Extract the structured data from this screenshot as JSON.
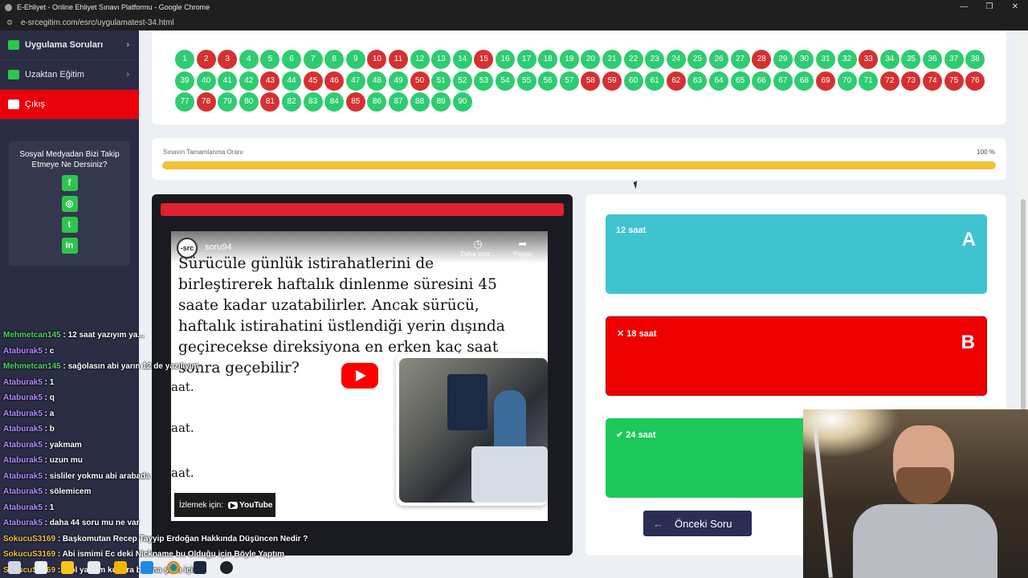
{
  "browser": {
    "window_title": "E-Ehliyet - Online Ehliyet Sınavı Platformu - Google Chrome",
    "url": "e-srcegitim.com/esrc/uygulamatest-34.html",
    "controls": [
      "—",
      "❐",
      "✕"
    ]
  },
  "sidebar": {
    "items": [
      {
        "label": "Uygulama Soruları",
        "chevron": "›"
      },
      {
        "label": "Uzaktan Eğitim",
        "chevron": "›"
      },
      {
        "label": "Çıkış"
      }
    ],
    "social_title": "Sosyal Medyadan Bizi Takip Etmeye Ne Dersiniz?",
    "social_icons": [
      {
        "name": "facebook-icon",
        "glyph": "f"
      },
      {
        "name": "instagram-icon",
        "glyph": "◎"
      },
      {
        "name": "twitter-icon",
        "glyph": "t"
      },
      {
        "name": "linkedin-icon",
        "glyph": "in"
      }
    ]
  },
  "question_numbers": {
    "rows": [
      [
        1,
        2,
        3,
        4,
        5,
        6,
        7,
        8,
        9,
        10,
        11,
        12,
        13,
        14,
        15,
        16,
        17,
        18,
        19,
        20,
        21,
        22,
        23,
        24,
        25,
        26,
        27,
        28,
        29,
        30,
        31,
        32,
        33,
        34,
        35,
        36,
        37,
        38
      ],
      [
        39,
        40,
        41,
        42,
        43,
        44,
        45,
        46,
        47,
        48,
        49,
        50,
        51,
        52,
        53,
        54,
        55,
        56,
        57,
        58,
        59,
        60,
        61,
        62,
        63,
        64,
        65,
        66,
        67,
        68,
        69,
        70,
        71,
        72,
        73,
        74,
        75,
        76
      ],
      [
        77,
        78,
        79,
        80,
        81,
        82,
        83,
        84,
        85,
        86,
        87,
        88,
        89,
        90
      ]
    ],
    "wrong": [
      2,
      3,
      10,
      11,
      15,
      28,
      33,
      43,
      45,
      46,
      50,
      58,
      59,
      62,
      69,
      72,
      73,
      74,
      75,
      76,
      78,
      81,
      85
    ],
    "colors": {
      "correct": "#2ecc71",
      "wrong": "#d63031"
    }
  },
  "progress": {
    "label": "Sınavın Tamamlanma Oranı",
    "value_text": "100 %",
    "fraction": 1.0,
    "color": "#f1c232"
  },
  "video": {
    "channel_logo": "-src",
    "title": "soru94",
    "watch_later": "Daha sonr...",
    "share": "Paylaş",
    "question_text": "Sürücüle günlük istirahatlerini de birleştirerek haftalık dinlenme süresini 45 saate kadar uzatabilirler. Ancak sürücü, haftalık istirahatini üstlendiği yerin dışında geçirecekse direksiyona en erken kaç saat sonra geçebilir?",
    "option_fragments": [
      "aat.",
      "aat.",
      "aat."
    ],
    "watch_on": "İzlemek için:",
    "youtube": "YouTube"
  },
  "answers": [
    {
      "text": "12 saat",
      "letter": "A",
      "status": ""
    },
    {
      "text": "✕ 18 saat",
      "letter": "B",
      "status": "wrong"
    },
    {
      "text": "✔ 24 saat",
      "letter": "C",
      "status": "correct"
    }
  ],
  "prev_button": {
    "label": "Önceki Soru",
    "arrow": "←"
  },
  "chat": [
    {
      "user": "Mehmetcan145",
      "msg": ": 12 saat yazıyım ya...",
      "top": 0,
      "color": "g"
    },
    {
      "user": "Ataburak5",
      "msg": ": c",
      "color": "p"
    },
    {
      "user": "Mehmetcan145",
      "msg": ": sağolasın abi yarın 12 de yazılıyım",
      "color": "g"
    },
    {
      "user": "Ataburak5",
      "msg": ": 1",
      "color": "p"
    },
    {
      "user": "Ataburak5",
      "msg": ": q",
      "color": "p"
    },
    {
      "user": "Ataburak5",
      "msg": ": a",
      "color": "p"
    },
    {
      "user": "Ataburak5",
      "msg": ": b",
      "color": "p"
    },
    {
      "user": "Ataburak5",
      "msg": ": yakmam",
      "color": "p"
    },
    {
      "user": "Ataburak5",
      "msg": ": uzun mu",
      "color": "p"
    },
    {
      "user": "Ataburak5",
      "msg": ": sisliler yokmu abi arabada",
      "color": "p"
    },
    {
      "user": "Ataburak5",
      "msg": ": sölemicem",
      "color": "p"
    },
    {
      "user": "Ataburak5",
      "msg": ": 1",
      "color": "p"
    },
    {
      "user": "Ataburak5",
      "msg": ": daha 44 soru mu ne var",
      "color": "p"
    },
    {
      "user": "SokucuS3169",
      "msg": ": Başkomutan Recep Tayyip Erdoğan Hakkında Düşüncen Nedir ?",
      "color": "y"
    },
    {
      "user": "SokucuS3169",
      "msg": ": Abi ismimi Ec deki Nickname bu Olduğu için Böyle Yaptım",
      "color": "y"
    },
    {
      "user": "SokucuS3169",
      "msg": ": Trol yaptım kusura bakma şaka için",
      "color": "y"
    }
  ]
}
